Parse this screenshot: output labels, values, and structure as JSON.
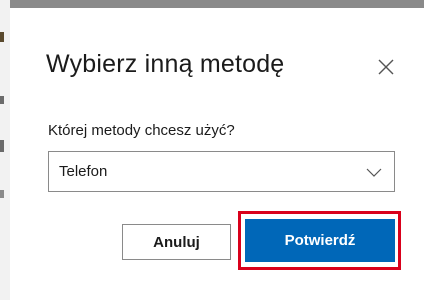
{
  "dialog": {
    "title": "Wybierz inną metodę",
    "close_icon": "close-icon",
    "question_label": "Której metody chcesz użyć?",
    "method_select": {
      "selected_value": "Telefon",
      "chevron_icon": "chevron-down-icon"
    },
    "buttons": {
      "cancel_label": "Anuluj",
      "confirm_label": "Potwierdź"
    }
  },
  "colors": {
    "primary_button": "#0067b8",
    "highlight_frame": "#d9001b",
    "text": "#1b1b1b",
    "border": "#8a8a8a"
  }
}
